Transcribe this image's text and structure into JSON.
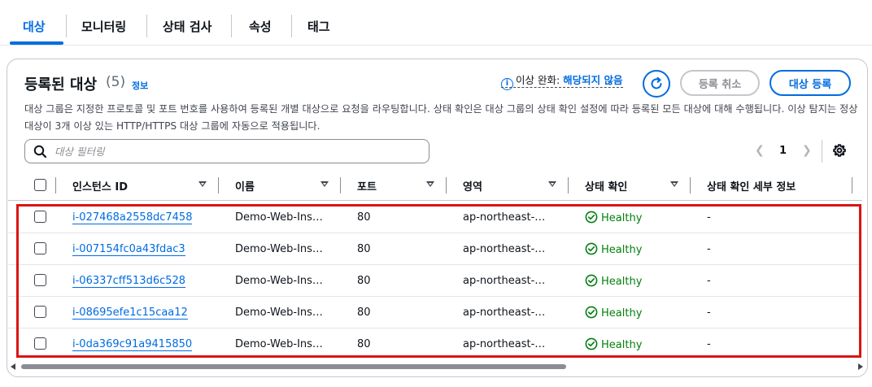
{
  "tabs": [
    "대상",
    "모니터링",
    "상태 검사",
    "속성",
    "태그"
  ],
  "header": {
    "title": "등록된 대상",
    "count": "(5)",
    "info": "정보",
    "anomaly_label": "이상 완화: ",
    "anomaly_value": "해당되지 않음",
    "deregister": "등록 취소",
    "register": "대상 등록"
  },
  "description": "대상 그룹은 지정한 프로토콜 및 포트 번호를 사용하여 등록된 개별 대상으로 요청을 라우팅합니다. 상태 확인은 대상 그룹의 상태 확인 설정에 따라 등록된 모든 대상에 대해 수행됩니다. 이상 탐지는 정상 대상이 3개 이상 있는 HTTP/HTTPS 대상 그룹에 자동으로 적용됩니다.",
  "search": {
    "placeholder": "대상 필터링"
  },
  "pagination": {
    "current": "1"
  },
  "columns": [
    "인스턴스 ID",
    "이름",
    "포트",
    "영역",
    "상태 확인",
    "상태 확인 세부 정보"
  ],
  "rows": [
    {
      "instance_id": "i-027468a2558dc7458",
      "name": "Demo-Web-Ins…",
      "port": "80",
      "zone": "ap-northeast-…",
      "health": "Healthy",
      "detail": "-"
    },
    {
      "instance_id": "i-007154fc0a43fdac3",
      "name": "Demo-Web-Ins…",
      "port": "80",
      "zone": "ap-northeast-…",
      "health": "Healthy",
      "detail": "-"
    },
    {
      "instance_id": "i-06337cff513d6c528",
      "name": "Demo-Web-Ins…",
      "port": "80",
      "zone": "ap-northeast-…",
      "health": "Healthy",
      "detail": "-"
    },
    {
      "instance_id": "i-08695efe1c15caa12",
      "name": "Demo-Web-Ins…",
      "port": "80",
      "zone": "ap-northeast-…",
      "health": "Healthy",
      "detail": "-"
    },
    {
      "instance_id": "i-0da369c91a9415850",
      "name": "Demo-Web-Ins…",
      "port": "80",
      "zone": "ap-northeast-…",
      "health": "Healthy",
      "detail": "-"
    }
  ],
  "colors": {
    "accent": "#006ce0",
    "healthy": "#037f0c",
    "highlight": "#d91515"
  }
}
